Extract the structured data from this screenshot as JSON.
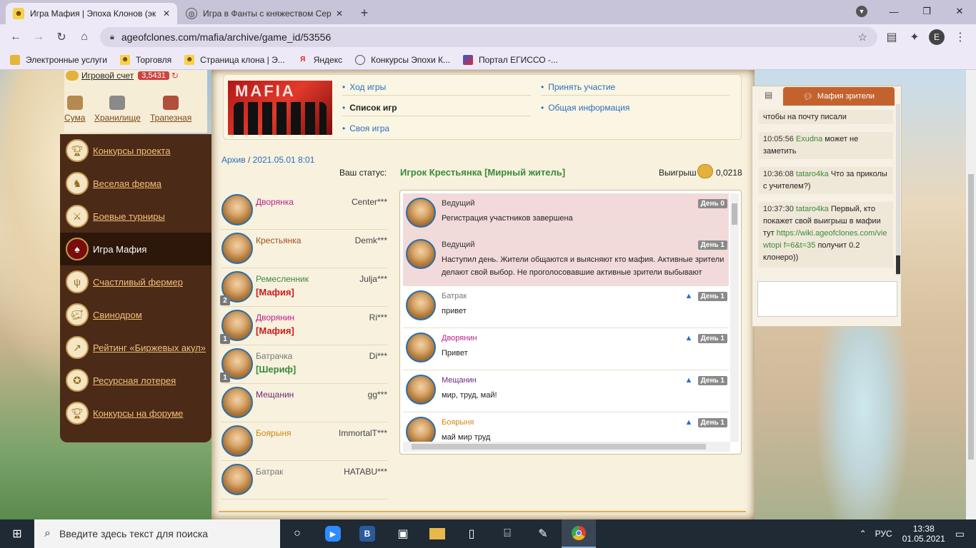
{
  "browser": {
    "tabs": [
      {
        "title": "Игра Мафия | Эпоха Клонов (эк",
        "close": "✕"
      },
      {
        "title": "Игра в Фанты с княжеством Сер",
        "close": "✕"
      }
    ],
    "new_tab": "+",
    "url": "ageofclones.com/mafia/archive/game_id/53556",
    "profile_initial": "E",
    "bookmarks": [
      {
        "label": "Электронные услуги"
      },
      {
        "label": "Торговля"
      },
      {
        "label": "Страница клона | Э..."
      },
      {
        "label": "Яндекс"
      },
      {
        "label": "Конкурсы Эпохи К..."
      },
      {
        "label": "Портал ЕГИССО -..."
      }
    ]
  },
  "sidebar": {
    "score_label": "Игровой счет",
    "score_value": "3,5431",
    "quick_links": [
      {
        "label": "Сума"
      },
      {
        "label": "Хранилище"
      },
      {
        "label": "Трапезная"
      }
    ],
    "menu": [
      {
        "label": "Конкурсы проекта",
        "icon": "trophy-icon"
      },
      {
        "label": "Веселая ферма",
        "icon": "farm-icon"
      },
      {
        "label": "Боевые турниры",
        "icon": "swords-icon"
      },
      {
        "label": "Игра Мафия",
        "icon": "mafia-icon",
        "active": true
      },
      {
        "label": "Счастливый фермер",
        "icon": "pitchfork-icon"
      },
      {
        "label": "Свинодром",
        "icon": "pig-icon"
      },
      {
        "label": "Рейтинг «Биржевых акул»",
        "icon": "chart-icon"
      },
      {
        "label": "Ресурсная лотерея",
        "icon": "lottery-icon"
      },
      {
        "label": "Конкурсы на форуме",
        "icon": "trophy-icon"
      }
    ]
  },
  "top_nav": {
    "banner_text": "MAFIA",
    "links_left": [
      "Ход игры",
      "Список игр",
      "Своя игра"
    ],
    "links_right": [
      "Принять участие",
      "Общая информация"
    ]
  },
  "game": {
    "crumb_archive": "Архив",
    "crumb_sep": "/",
    "crumb_date": "2021.05.01 8:01",
    "status_label": "Ваш статус:",
    "status_value": "Игрок Крестьянка [Мирный житель]",
    "win_label": "Выигрыш",
    "win_value": "0,0218"
  },
  "players": [
    {
      "role": "Дворянка",
      "nick": "Center***",
      "role_color": "#c0208a",
      "tag": "",
      "badge": ""
    },
    {
      "role": "Крестьянка",
      "nick": "Demk***",
      "role_color": "#a0501a",
      "tag": "",
      "badge": ""
    },
    {
      "role": "Ремесленник",
      "nick": "Julja***",
      "role_color": "#3a8a3a",
      "tag": "[Мафия]",
      "tag_color": "#d01a1a",
      "badge": "2"
    },
    {
      "role": "Дворянин",
      "nick": "Ri***",
      "role_color": "#c0208a",
      "tag": "[Мафия]",
      "tag_color": "#d01a1a",
      "badge": "1"
    },
    {
      "role": "Батрачка",
      "nick": "Di***",
      "role_color": "#777777",
      "tag": "[Шериф]",
      "tag_color": "#3a8a3a",
      "badge": "1"
    },
    {
      "role": "Мещанин",
      "nick": "gg***",
      "role_color": "#6a2a7a",
      "tag": "",
      "badge": ""
    },
    {
      "role": "Боярыня",
      "nick": "ImmortalT***",
      "role_color": "#d08a10",
      "tag": "",
      "badge": ""
    },
    {
      "role": "Батрак",
      "nick": "HATABU***",
      "role_color": "#777777",
      "tag": "",
      "badge": ""
    }
  ],
  "chat": [
    {
      "name": "Ведущий",
      "name_color": "#333333",
      "text": "Регистрация участников завершена",
      "day": "День 0",
      "pink": true,
      "warn": false,
      "h": 58
    },
    {
      "name": "Ведущий",
      "name_color": "#333333",
      "text": "Наступил день. Жители общаются и выясняют кто мафия. Активные зрители делают свой выбор. Не проголосовавшие активные зрители выбывают",
      "day": "День 1",
      "pink": true,
      "warn": false,
      "h": 72
    },
    {
      "name": "Батрак",
      "name_color": "#777777",
      "text": "привет",
      "day": "День 1",
      "pink": false,
      "warn": true,
      "h": 59
    },
    {
      "name": "Дворянин",
      "name_color": "#c0208a",
      "text": "Привет",
      "day": "День 1",
      "pink": false,
      "warn": true,
      "h": 59
    },
    {
      "name": "Мещанин",
      "name_color": "#6a2a7a",
      "text": "мир, труд, май!",
      "day": "День 1",
      "pink": false,
      "warn": true,
      "h": 59
    },
    {
      "name": "Боярыня",
      "name_color": "#d08a10",
      "text": "май мир труд",
      "day": "День 1",
      "pink": false,
      "warn": true,
      "h": 59
    }
  ],
  "right_chat": {
    "tab_label": "Мафия зрители",
    "messages": [
      {
        "time": "",
        "nick": "",
        "text": "чтобы на почту писали"
      },
      {
        "time": "10:05:56",
        "nick": "Exudna",
        "text": "может не заметить"
      },
      {
        "time": "10:36:08",
        "nick": "tataro4ka",
        "text": "Что за приколы с учителем?)"
      },
      {
        "time": "10:37:30",
        "nick": "tataro4ka",
        "text": "Первый, кто покажет свой выигрыш в мафии тут",
        "link": "https://wiki.ageofclones.com/viewtopic.php?f=6&t=35",
        "link_display": "https://wiki.ageofclones.com/viewtopi f=6&t=35",
        "after": "получит 0.2 клонеро))"
      }
    ]
  },
  "taskbar": {
    "search_placeholder": "Введите здесь текст для поиска",
    "lang": "РУС",
    "time": "13:38",
    "date": "01.05.2021"
  }
}
